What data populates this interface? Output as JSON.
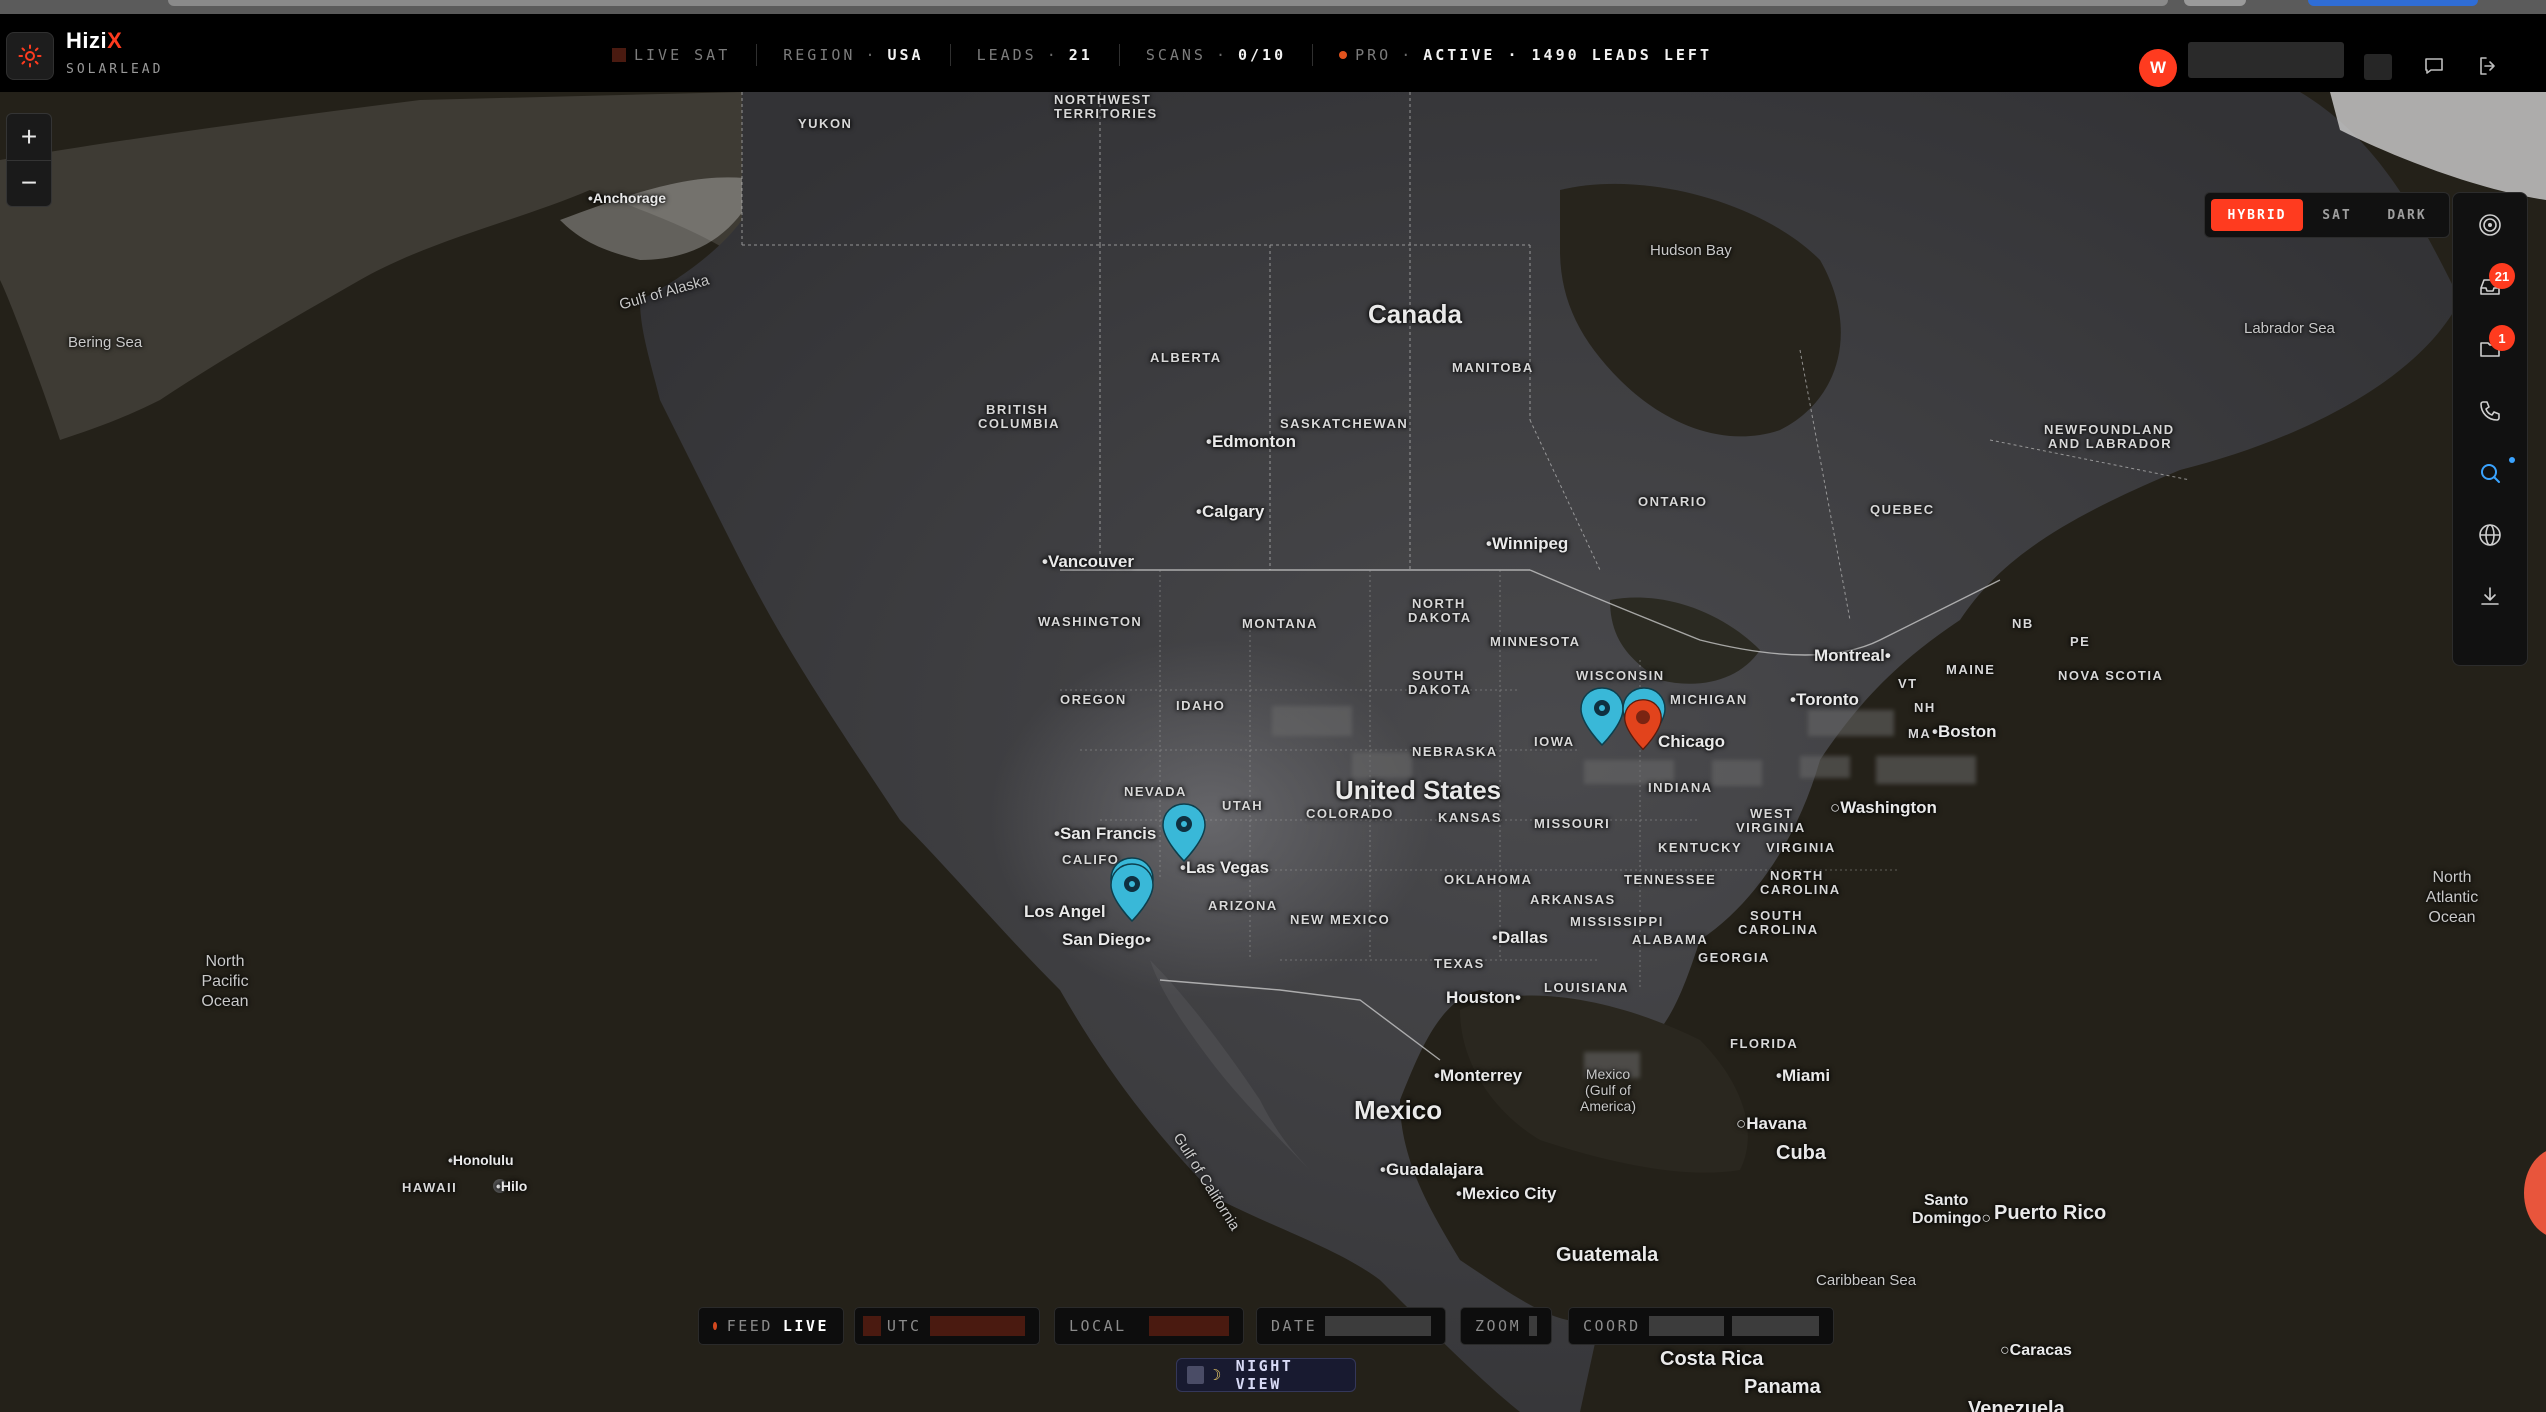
{
  "app": {
    "brand_name": "Hizi",
    "brand_accent": "X",
    "brand_subtitle": "SOLARLEAD",
    "accent_color": "#ff3b1f"
  },
  "topbar": {
    "live_sat_label": "LIVE SAT",
    "region_label": "REGION",
    "region_value": "USA",
    "leads_label": "LEADS",
    "leads_value": "21",
    "scans_label": "SCANS",
    "scans_value": "0/10",
    "plan_label": "PRO",
    "plan_status": "ACTIVE · 1490 LEADS LEFT",
    "separator": "·",
    "avatar_initial": "W",
    "icons": [
      "message-icon",
      "logout-icon"
    ]
  },
  "map_controls": {
    "zoom_in": "+",
    "zoom_out": "−",
    "layers": [
      {
        "label": "HYBRID",
        "active": true
      },
      {
        "label": "SAT",
        "active": false
      },
      {
        "label": "DARK",
        "active": false
      }
    ]
  },
  "rail": {
    "items": [
      {
        "icon": "target-icon",
        "badge": null
      },
      {
        "icon": "inbox-icon",
        "badge": "21"
      },
      {
        "icon": "folder-icon",
        "badge": "1"
      },
      {
        "icon": "phone-icon",
        "badge": null
      },
      {
        "icon": "search-icon",
        "badge": null,
        "active": true
      },
      {
        "icon": "globe-icon",
        "badge": null
      },
      {
        "icon": "download-icon",
        "badge": null
      }
    ]
  },
  "map_labels": {
    "countries": {
      "canada": "Canada",
      "united_states": "United States",
      "mexico": "Mexico",
      "cuba": "Cuba",
      "guatemala": "Guatemala",
      "costa_rica": "Costa Rica",
      "panama": "Panama",
      "puerto_rico": "Puerto Rico",
      "venezuela": "Venezuela"
    },
    "regions": {
      "yukon": "YUKON",
      "nwt_1": "NORTHWEST",
      "nwt_2": "TERRITORIES",
      "alberta": "ALBERTA",
      "bc_1": "BRITISH",
      "bc_2": "COLUMBIA",
      "saskatchewan": "SASKATCHEWAN",
      "manitoba": "MANITOBA",
      "ontario": "ONTARIO",
      "quebec": "QUEBEC",
      "nl_1": "NEWFOUNDLAND",
      "nl_2": "AND LABRADOR",
      "nb": "NB",
      "pe": "PE",
      "nova_scotia": "NOVA SCOTIA",
      "washington": "WASHINGTON",
      "montana": "MONTANA",
      "nd_1": "NORTH",
      "nd_2": "DAKOTA",
      "sd_1": "SOUTH",
      "sd_2": "DAKOTA",
      "minnesota": "MINNESOTA",
      "wisconsin": "WISCONSIN",
      "michigan": "MICHIGAN",
      "oregon": "OREGON",
      "idaho": "IDAHO",
      "nebraska": "NEBRASKA",
      "iowa": "IOWA",
      "nevada": "NEVADA",
      "utah": "UTAH",
      "colorado": "COLORADO",
      "kansas": "KANSAS",
      "missouri": "MISSOURI",
      "indiana": "INDIANA",
      "california": "CALIFO",
      "arizona": "ARIZONA",
      "new_mexico": "NEW MEXICO",
      "oklahoma": "OKLAHOMA",
      "arkansas": "ARKANSAS",
      "tennessee": "TENNESSEE",
      "kentucky": "KENTUCKY",
      "wv_1": "WEST",
      "wv_2": "VIRGINIA",
      "virginia": "VIRGINIA",
      "nc_1": "NORTH",
      "nc_2": "CAROLINA",
      "sc_1": "SOUTH",
      "sc_2": "CAROLINA",
      "mississippi": "MISSISSIPPI",
      "alabama": "ALABAMA",
      "georgia": "GEORGIA",
      "texas": "TEXAS",
      "louisiana": "LOUISIANA",
      "florida": "FLORIDA",
      "maine": "MAINE",
      "vt": "VT",
      "nh": "NH",
      "ma": "MA",
      "hawaii": "HAWAII"
    },
    "cities": {
      "anchorage": "Anchorage",
      "edmonton": "Edmonton",
      "calgary": "Calgary",
      "vancouver": "Vancouver",
      "winnipeg": "Winnipeg",
      "montreal": "Montreal",
      "toronto": "Toronto",
      "boston": "Boston",
      "chicago": "Chicago",
      "washington": "Washington",
      "san_francisco": "San Francis",
      "las_vegas": "Las Vegas",
      "los_angeles": "Los Angel",
      "san_diego": "San Diego",
      "dallas": "Dallas",
      "houston": "Houston",
      "monterrey": "Monterrey",
      "guadalajara": "Guadalajara",
      "mexico_city": "Mexico City",
      "miami": "Miami",
      "havana": "Havana",
      "santo_domingo_1": "Santo",
      "santo_domingo_2": "Domingo",
      "caracas": "Caracas",
      "honolulu": "Honolulu",
      "hilo": "Hilo"
    },
    "water": {
      "bering_sea": "Bering Sea",
      "gulf_of_alaska": "Gulf of Alaska",
      "hudson_bay": "Hudson Bay",
      "labrador_sea": "Labrador Sea",
      "north_pacific_1": "North",
      "north_pacific_2": "Pacific",
      "north_pacific_3": "Ocean",
      "north_atlantic_1": "North",
      "north_atlantic_2": "Atlantic",
      "north_atlantic_3": "Ocean",
      "gulf_of_california": "Gulf of California",
      "gulf_mexico_1": "Mexico",
      "gulf_mexico_2": "(Gulf of",
      "gulf_mexico_3": "America)",
      "caribbean_sea": "Caribbean Sea"
    }
  },
  "bottom_bar": {
    "feed_label": "FEED",
    "feed_value": "LIVE",
    "utc_label": "UTC",
    "local_label": "LOCAL",
    "date_label": "DATE",
    "zoom_label": "ZOOM",
    "coord_label": "COORD",
    "night_view_label": "NIGHT VIEW"
  },
  "colors": {
    "pin_lead": "#39b8d8",
    "pin_selected": "#e2431c",
    "land": "#3a3a3c",
    "ocean": "#242119"
  }
}
